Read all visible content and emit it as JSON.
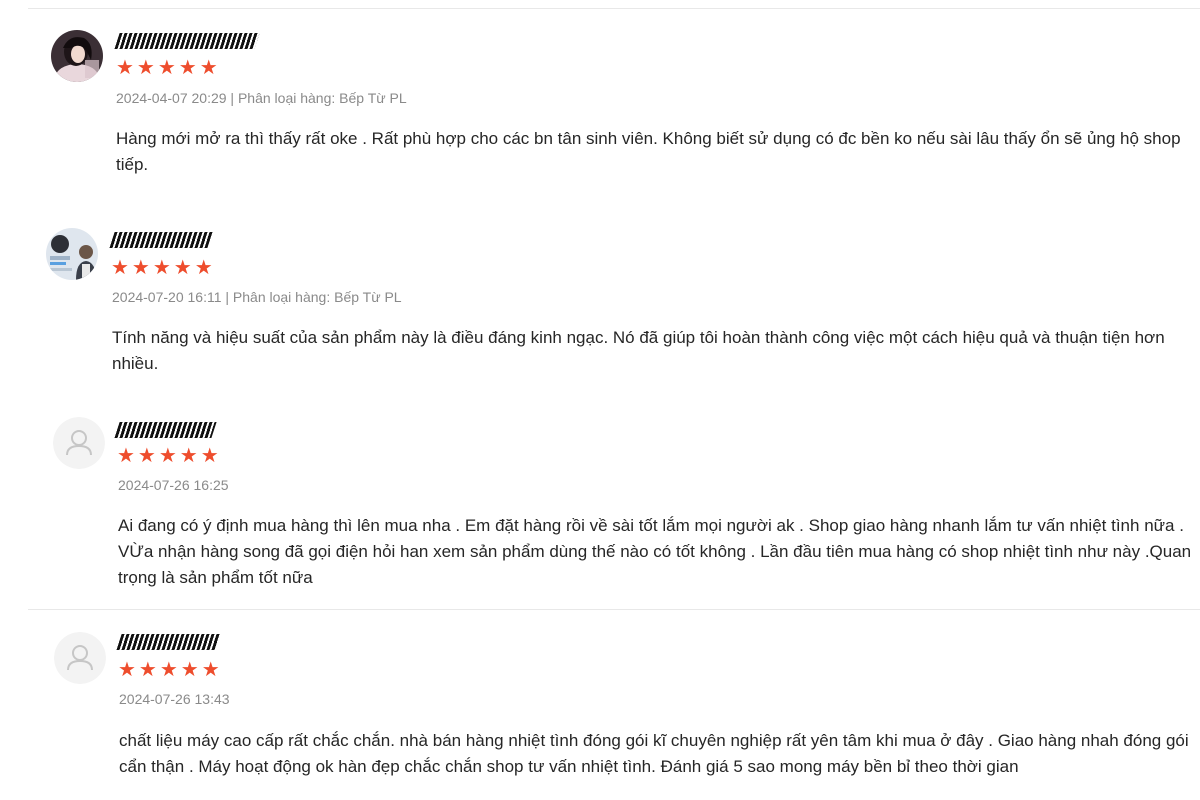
{
  "reviews": [
    {
      "avatar": "user-photo-avatar-woman",
      "stars": "★★★★★",
      "rating": 5,
      "date": "2024-04-07 20:29",
      "variation": " | Phân loại hàng: Bếp Từ PL",
      "text": "Hàng mới mở ra thì thấy rất oke . Rất phù hợp cho các bn tân sinh viên. Không biết sử dụng có đc bền ko nếu sài lâu thấy ổn sẽ ủng hộ shop tiếp."
    },
    {
      "avatar": "user-photo-avatar-man",
      "stars": "★★★★★",
      "rating": 5,
      "date": "2024-07-20 16:11",
      "variation": " | Phân loại hàng: Bếp Từ PL",
      "text": "Tính năng và hiệu suất của sản phẩm này là điều đáng kinh ngạc. Nó đã giúp tôi hoàn thành công việc một cách hiệu quả và thuận tiện hơn nhiều."
    },
    {
      "avatar": "default-user-icon",
      "stars": "★★★★★",
      "rating": 5,
      "date": "2024-07-26 16:25",
      "variation": "",
      "text": "Ai đang có ý định mua hàng thì lên mua nha . Em đặt hàng rồi về sài tốt lắm mọi người ak . Shop giao hàng nhanh lắm tư vấn nhiệt tình nữa . VỪa nhận hàng song đã gọi điện hỏi han xem sản phẩm dùng thế nào có tốt không . Lần đầu tiên mua hàng có shop nhiệt tình như này .Quan trọng là sản phẩm tốt nữa"
    },
    {
      "avatar": "default-user-icon",
      "stars": "★★★★★",
      "rating": 5,
      "date": "2024-07-26 13:43",
      "variation": "",
      "text": "chất liệu máy cao cấp rất chắc chắn. nhà bán hàng nhiệt tình đóng gói kĩ chuyên nghiệp rất yên tâm khi mua ở đây . Giao hàng nhah đóng gói cẩn thận . Máy hoạt động ok hàn đẹp chắc chắn shop tư vấn nhiệt tình. Đánh giá 5 sao mong máy bền bỉ theo thời gian"
    }
  ],
  "colors": {
    "star": "#ee4d2d",
    "meta": "#8a8a8a",
    "divider": "#e8e8e8",
    "default_avatar_bg": "#f3f3f3",
    "default_avatar_icon": "#c6c6c6"
  }
}
